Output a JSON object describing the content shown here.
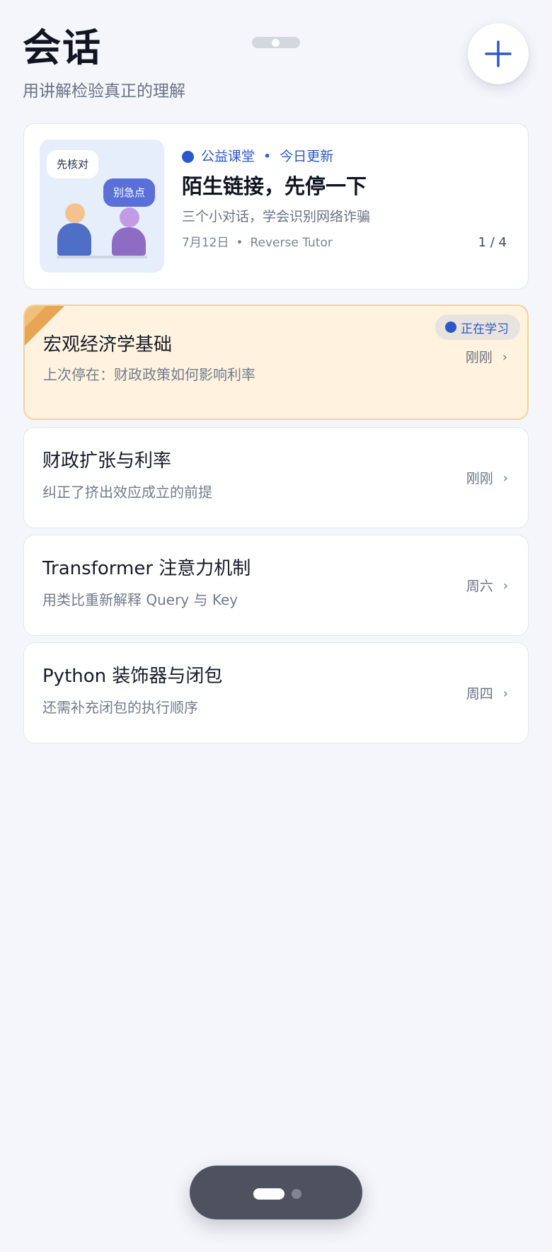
{
  "header": {
    "title": "会话",
    "subtitle": "用讲解检验真正的理解"
  },
  "featured": {
    "thumb_bubble_left": "先核对",
    "thumb_bubble_right": "别急点",
    "tag_left": "公益课堂",
    "tag_separator": "•",
    "tag_right": "今日更新",
    "title": "陌生链接，先停一下",
    "description": "三个小对话，学会识别网络诈骗",
    "date": "7月12日",
    "meta_separator": "•",
    "source": "Reverse Tutor",
    "page": "1 / 4"
  },
  "active_session": {
    "status": "正在学习",
    "title": "宏观经济学基础",
    "subtitle": "上次停在：财政政策如何影响利率",
    "time": "刚刚",
    "chevron": "›"
  },
  "sessions": [
    {
      "title": "财政扩张与利率",
      "subtitle": "纠正了挤出效应成立的前提",
      "time": "刚刚",
      "chevron": "›"
    },
    {
      "title": "Transformer 注意力机制",
      "subtitle": "用类比重新解释 Query 与 Key",
      "time": "周六",
      "chevron": "›"
    },
    {
      "title": "Python 装饰器与闭包",
      "subtitle": "还需补充闭包的执行顺序",
      "time": "周四",
      "chevron": "›"
    }
  ],
  "icons": {
    "add": "plus-icon",
    "chevron": "chevron-right-icon",
    "ribbon": "corner-ribbon"
  },
  "colors": {
    "accent": "#2c58c9",
    "active_bg": "#fff3df",
    "active_border": "#f3d39e",
    "ribbon": "#e8a553"
  }
}
